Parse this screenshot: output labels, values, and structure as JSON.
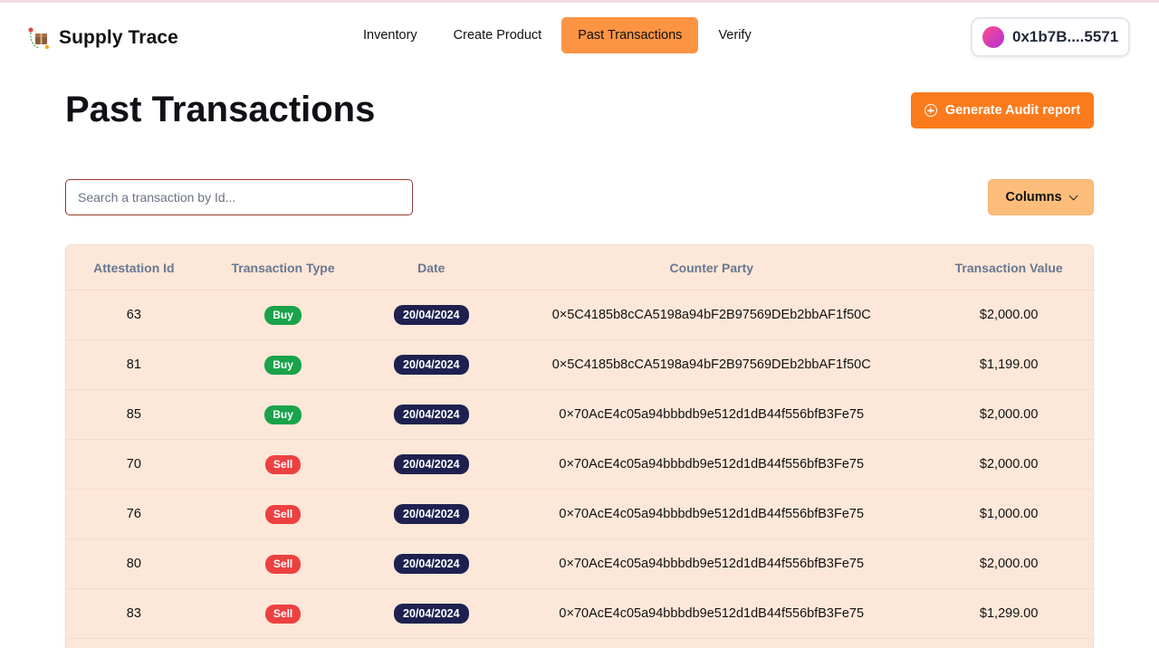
{
  "header": {
    "brand": "Supply Trace",
    "nav": [
      {
        "label": "Inventory",
        "active": false
      },
      {
        "label": "Create Product",
        "active": false
      },
      {
        "label": "Past Transactions",
        "active": true
      },
      {
        "label": "Verify",
        "active": false
      }
    ],
    "wallet_address": "0x1b7B....5571"
  },
  "page": {
    "title": "Past Transactions",
    "audit_button": "Generate Audit report",
    "search_placeholder": "Search a transaction by Id...",
    "columns_button": "Columns"
  },
  "table": {
    "headers": [
      "Attestation Id",
      "Transaction Type",
      "Date",
      "Counter Party",
      "Transaction Value"
    ],
    "rows": [
      {
        "id": "63",
        "type": "Buy",
        "date": "20/04/2024",
        "party": "0×5C4185b8cCA5198a94bF2B97569DEb2bbAF1f50C",
        "value": "$2,000.00"
      },
      {
        "id": "81",
        "type": "Buy",
        "date": "20/04/2024",
        "party": "0×5C4185b8cCA5198a94bF2B97569DEb2bbAF1f50C",
        "value": "$1,199.00"
      },
      {
        "id": "85",
        "type": "Buy",
        "date": "20/04/2024",
        "party": "0×70AcE4c05a94bbbdb9e512d1dB44f556bfB3Fe75",
        "value": "$2,000.00"
      },
      {
        "id": "70",
        "type": "Sell",
        "date": "20/04/2024",
        "party": "0×70AcE4c05a94bbbdb9e512d1dB44f556bfB3Fe75",
        "value": "$2,000.00"
      },
      {
        "id": "76",
        "type": "Sell",
        "date": "20/04/2024",
        "party": "0×70AcE4c05a94bbbdb9e512d1dB44f556bfB3Fe75",
        "value": "$1,000.00"
      },
      {
        "id": "80",
        "type": "Sell",
        "date": "20/04/2024",
        "party": "0×70AcE4c05a94bbbdb9e512d1dB44f556bfB3Fe75",
        "value": "$2,000.00"
      },
      {
        "id": "83",
        "type": "Sell",
        "date": "20/04/2024",
        "party": "0×70AcE4c05a94bbbdb9e512d1dB44f556bfB3Fe75",
        "value": "$1,299.00"
      }
    ]
  },
  "colors": {
    "accent": "#fb7b1c",
    "nav_active": "#fd9443",
    "table_bg": "#fde7d8",
    "buy": "#1aa34a",
    "sell": "#ec4141",
    "date_badge": "#1e2150"
  },
  "icons": {
    "brand": "package-route-icon",
    "audit": "plus-circle-icon",
    "columns": "chevron-down-icon",
    "wallet": "avatar-gradient"
  }
}
